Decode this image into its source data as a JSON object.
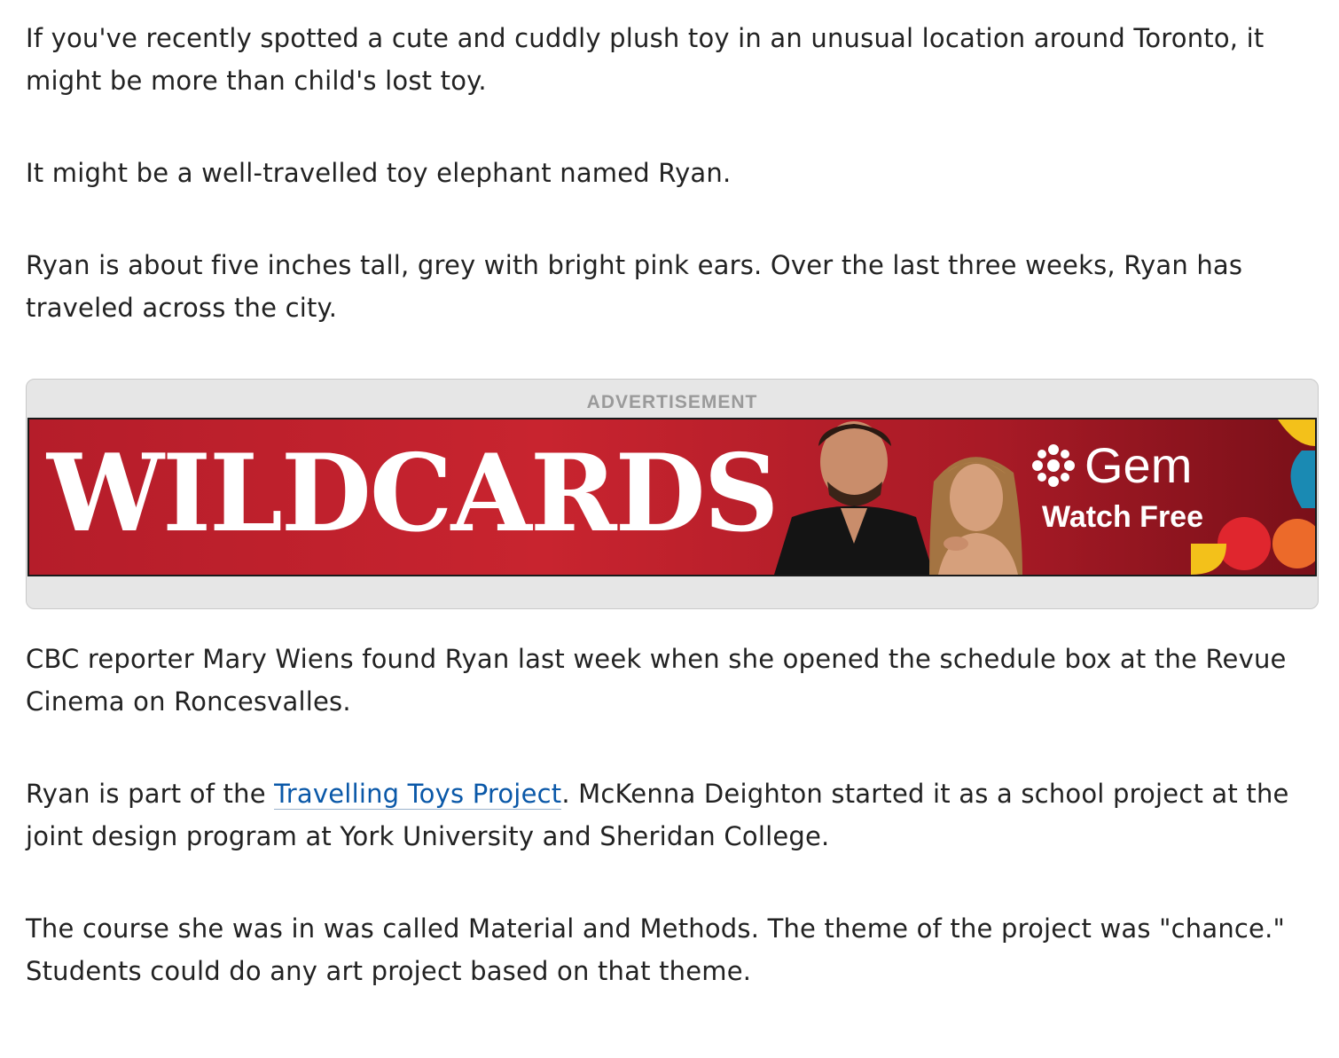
{
  "article": {
    "p1": "If you've recently spotted a cute and cuddly plush toy in an unusual location around Toronto, it might be more than child's lost toy.",
    "p2": "It might be a well-travelled toy elephant named Ryan.",
    "p3": "Ryan is about five inches tall, grey with bright pink ears. Over the last three weeks, Ryan has traveled across the city.",
    "p4": "CBC reporter Mary Wiens found Ryan last week when she opened the schedule box at the Revue Cinema on Roncesvalles.",
    "p5_before": "Ryan is part of the ",
    "p5_link": "Travelling Toys Project",
    "p5_after": ". McKenna Deighton started it as a school project at the joint design program at York University and Sheridan College.",
    "p6": "The course she was in was called Material and Methods. The theme of the project was \"chance.\" Students could do any art project based on that theme."
  },
  "ad": {
    "label": "ADVERTISEMENT",
    "banner_title": "WILDCARDS",
    "brand": "Gem",
    "cta": "Watch Free"
  },
  "colors": {
    "link": "#0a58a8",
    "banner_red": "#c8242f",
    "text": "#222222"
  }
}
